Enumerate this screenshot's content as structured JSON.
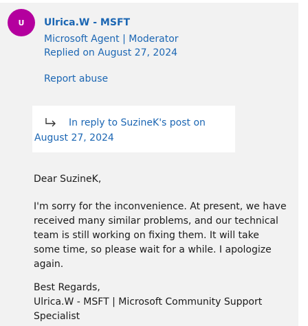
{
  "author": {
    "initial": "U",
    "name": "Ulrica.W - MSFT",
    "role_primary": "Microsoft Agent",
    "role_separator": "|",
    "role_secondary": "Moderator",
    "replied": "Replied on August 27, 2024",
    "avatar_color": "#b4009e"
  },
  "actions": {
    "report_abuse": "Report abuse"
  },
  "reply_reference": {
    "icon": "reply-arrow-icon",
    "text": "In reply to SuzineK's post on August 27, 2024"
  },
  "message": {
    "greeting": "Dear SuzineK,",
    "body": "I'm sorry for the inconvenience. At present, we have received many similar problems, and our technical team is still working on fixing them. It will take some time, so please wait for a while. I apologize again.",
    "closing_line1": "Best Regards,",
    "closing_line2": "Ulrica.W - MSFT | Microsoft Community Support Specialist"
  },
  "colors": {
    "link": "#1b66b3",
    "card_background": "#f2f2f2",
    "text": "#1a1a1a"
  }
}
